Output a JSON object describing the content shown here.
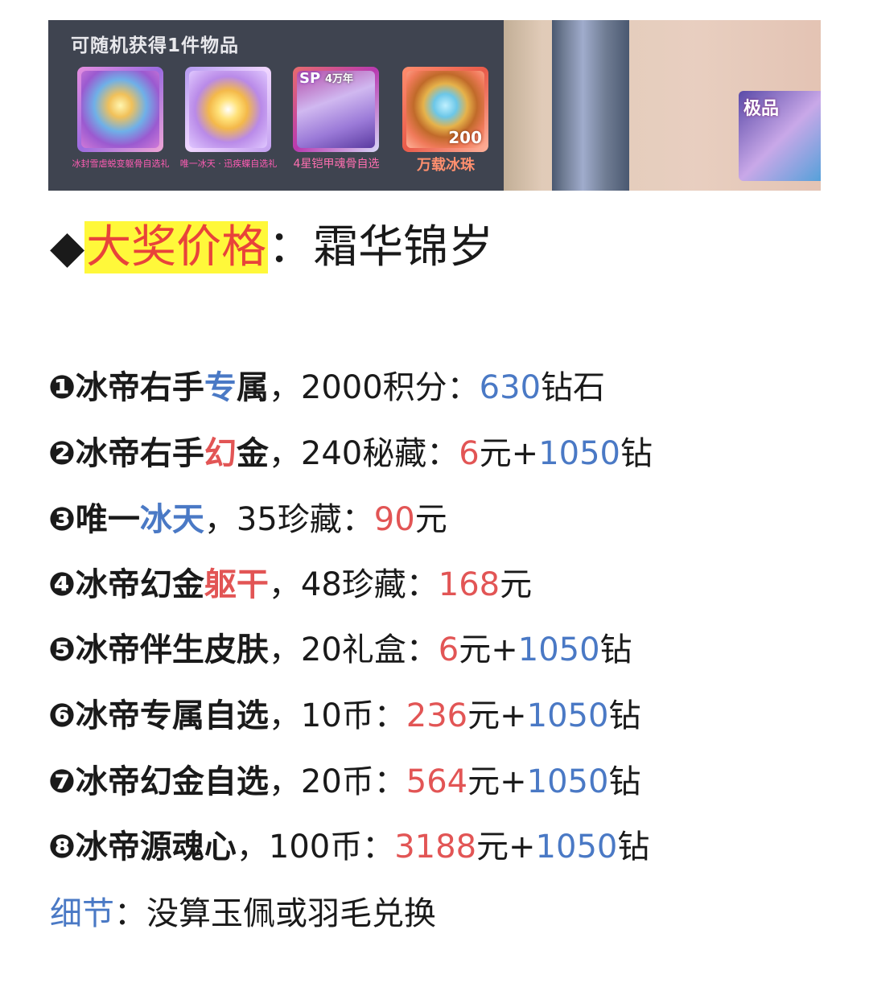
{
  "banner": {
    "title": "可随机获得1件物品",
    "items": [
      {
        "caption": "冰封雪虐蜕变躯骨自选礼",
        "icon": "winged-armor-icon"
      },
      {
        "caption": "唯一冰天 · 迅疾蝶自选礼",
        "icon": "butterfly-wings-icon"
      },
      {
        "caption": "4星铠甲魂骨自选",
        "sp": "SP",
        "age": "4万年",
        "icon": "soul-bone-icon"
      },
      {
        "caption": "万载冰珠",
        "count": "200",
        "icon": "ice-pearl-icon"
      }
    ],
    "jackpot_label": "极品"
  },
  "heading": {
    "diamond": "◆",
    "highlight": "大奖价格",
    "colon": "：",
    "title": "霜华锦岁"
  },
  "items": [
    {
      "marker": "❶",
      "a": "冰帝右手",
      "b": "专",
      "c": "属",
      "sep": "，",
      "cost": "2000积分：",
      "p1": "630",
      "p2": "钻石",
      "p3": "",
      "p4": ""
    },
    {
      "marker": "❷",
      "a": "冰帝右手",
      "b": "幻",
      "c": "金",
      "sep": "，",
      "cost": "240秘藏：",
      "p1": "6",
      "p2": "元+",
      "p3": "1050",
      "p4": "钻"
    },
    {
      "marker": "❸",
      "a": "唯一",
      "b": "冰天",
      "c": "",
      "sep": "，",
      "cost": "35珍藏：",
      "p1": "90",
      "p2": "元",
      "p3": "",
      "p4": ""
    },
    {
      "marker": "❹",
      "a": "冰帝幻金",
      "b": "躯干",
      "c": "",
      "sep": "，",
      "cost": "48珍藏：",
      "p1": "168",
      "p2": "元",
      "p3": "",
      "p4": ""
    },
    {
      "marker": "❺",
      "a": "冰帝伴生皮肤",
      "b": "",
      "c": "",
      "sep": "，",
      "cost": "20礼盒：",
      "p1": "6",
      "p2": "元+",
      "p3": "1050",
      "p4": "钻"
    },
    {
      "marker": "❻",
      "a": "冰帝专属自选",
      "b": "",
      "c": "",
      "sep": "，",
      "cost": "10币：",
      "p1": "236",
      "p2": "元+",
      "p3": "1050",
      "p4": "钻"
    },
    {
      "marker": "❼",
      "a": "冰帝幻金自选",
      "b": "",
      "c": "",
      "sep": "，",
      "cost": "20币：",
      "p1": "564",
      "p2": "元+",
      "p3": "1050",
      "p4": "钻"
    },
    {
      "marker": "❽",
      "a": "冰帝源魂心",
      "b": "",
      "c": "",
      "sep": "，",
      "cost": "100币：",
      "p1": "3188",
      "p2": "元+",
      "p3": "1050",
      "p4": "钻"
    }
  ],
  "note": {
    "label": "细节",
    "colon": "：",
    "text": "没算玉佩或羽毛兑换"
  }
}
